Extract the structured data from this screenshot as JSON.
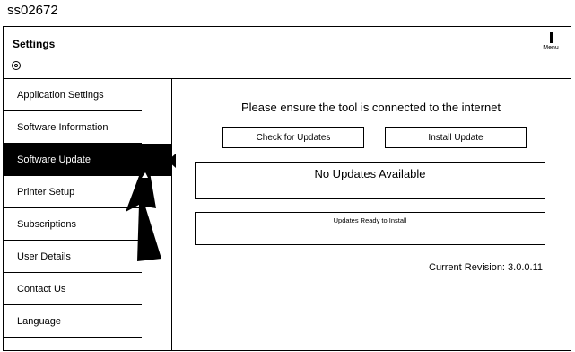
{
  "doc_id": "ss02672",
  "header": {
    "title": "Settings",
    "menu_label": "Menu"
  },
  "sidebar": {
    "items": [
      {
        "label": "Application Settings"
      },
      {
        "label": "Software Information"
      },
      {
        "label": "Software Update",
        "active": true
      },
      {
        "label": "Printer Setup"
      },
      {
        "label": "Subscriptions"
      },
      {
        "label": "User Details"
      },
      {
        "label": "Contact Us"
      },
      {
        "label": "Language"
      }
    ]
  },
  "main": {
    "instruction": "Please ensure the tool is connected to the internet",
    "check_button": "Check for Updates",
    "install_button": "Install Update",
    "status_text": "No Updates Available",
    "ready_label": "Updates Ready to Install",
    "revision_text": "Current Revision: 3.0.0.11"
  },
  "icons": {
    "settings": "settings-icon",
    "menu": "menu-icon"
  },
  "colors": {
    "active_bg": "#000000",
    "active_fg": "#ffffff"
  }
}
